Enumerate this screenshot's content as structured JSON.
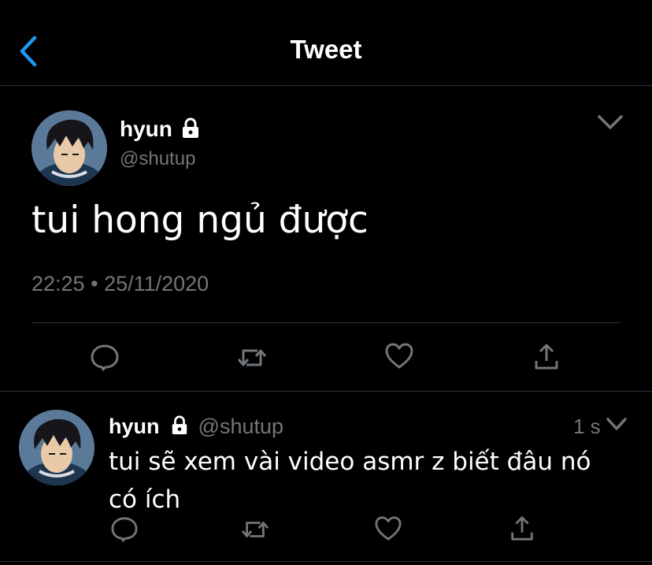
{
  "header": {
    "title": "Tweet",
    "back_icon": "chevron-left-icon",
    "accent": "#1d9bf0"
  },
  "tweet": {
    "name": "hyun",
    "handle": "@shutup",
    "text": "tui hong ngủ được",
    "time": "22:25",
    "separator": "•",
    "date": "25/11/2020",
    "icons": [
      "reply-icon",
      "retweet-icon",
      "like-icon",
      "share-icon"
    ]
  },
  "reply": {
    "name": "hyun",
    "handle": "@shutup",
    "timestamp": "1 s",
    "text": "tui sẽ xem vài video asmr z biết đâu nó có ích"
  },
  "colors": {
    "background": "#000000",
    "text": "#ffffff",
    "secondary": "#71767b",
    "divider": "#2f3336"
  }
}
